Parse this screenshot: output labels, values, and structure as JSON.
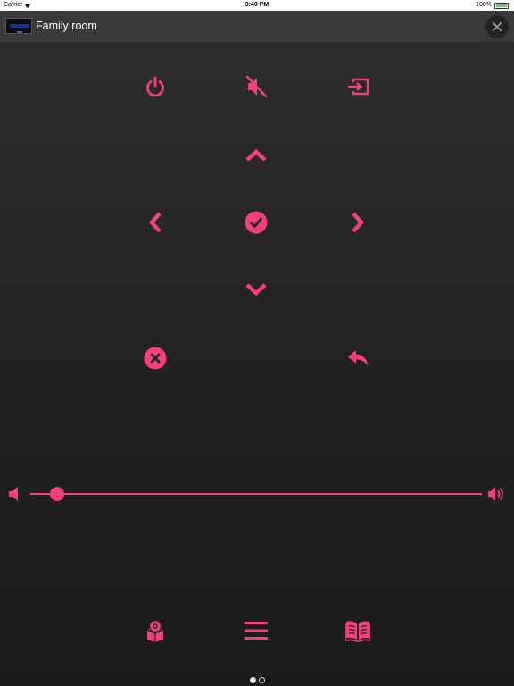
{
  "status_bar": {
    "carrier": "Carrier",
    "time": "3:40 PM",
    "battery": "100%",
    "wifi_icon": "wifi-icon",
    "battery_level": 1.0
  },
  "header": {
    "title": "Family room",
    "thumbnail_icon": "tv-icon",
    "close_icon": "close-icon"
  },
  "colors": {
    "accent": "#f2417b",
    "background": "#242424",
    "header": "#3a3a3a"
  },
  "remote": {
    "top_row": [
      "power-icon",
      "mute-icon",
      "input-source-icon"
    ],
    "dpad": [
      "up-arrow-icon",
      "left-arrow-icon",
      "ok-check-icon",
      "right-arrow-icon",
      "down-arrow-icon"
    ],
    "action_row": [
      "cancel-icon",
      "back-icon"
    ],
    "bottom_row": [
      "smart-hub-icon",
      "menu-icon",
      "guide-book-icon"
    ]
  },
  "volume": {
    "level": 0.06,
    "min_icon": "volume-low-icon",
    "max_icon": "volume-high-icon"
  },
  "pagination": {
    "pages": 2,
    "current": 1
  }
}
